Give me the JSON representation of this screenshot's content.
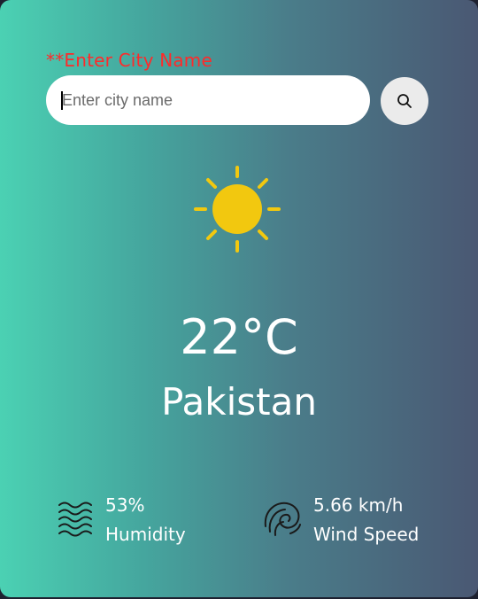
{
  "search": {
    "error_text": "**Enter City Name",
    "placeholder": "Enter city name",
    "value": "",
    "button_icon": "search-icon"
  },
  "weather": {
    "icon": "sun-icon",
    "icon_color": "#f2c80f",
    "temperature": "22°C",
    "city": "Pakistan"
  },
  "details": {
    "humidity": {
      "icon": "humidity-waves-icon",
      "value": "53%",
      "label": "Humidity"
    },
    "wind": {
      "icon": "wind-swirl-icon",
      "value": "5.66 km/h",
      "label": "Wind Speed"
    }
  },
  "colors": {
    "gradient_start": "#4bd1b3",
    "gradient_end": "#4a5873",
    "error_text": "#ff2a2a",
    "text": "#ffffff"
  }
}
